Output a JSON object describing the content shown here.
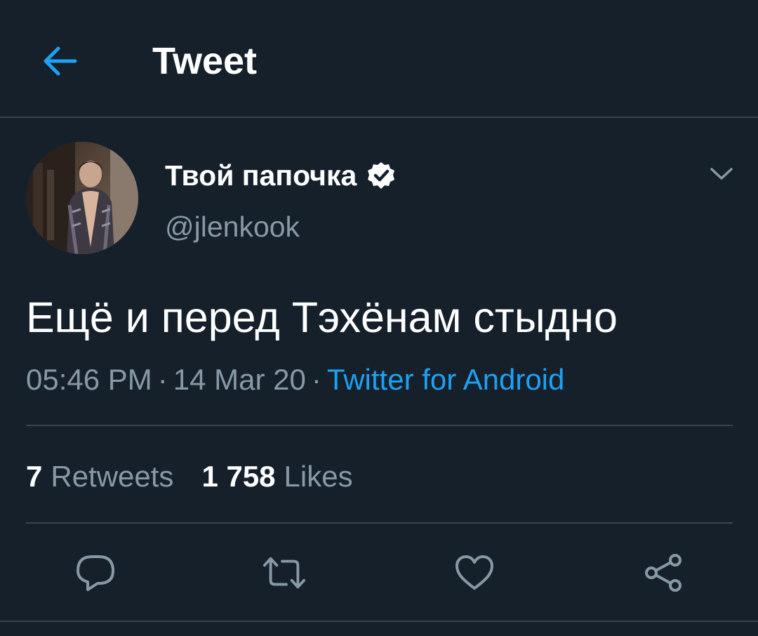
{
  "header": {
    "title": "Tweet",
    "back_icon": "arrow-left-icon"
  },
  "author": {
    "display_name": "Твой папочка",
    "handle": "@jlenkook",
    "verified": true,
    "verified_icon": "verified-badge-icon",
    "menu_icon": "chevron-down-icon"
  },
  "tweet": {
    "text": "Ещё и перед Тэхёнам стыдно",
    "time": "05:46 PM",
    "separator": "·",
    "date": "14 Mar 20",
    "source": "Twitter for Android"
  },
  "stats": {
    "retweets_count": "7",
    "retweets_label": "Retweets",
    "likes_count": "1 758",
    "likes_label": "Likes"
  },
  "actions": [
    {
      "name": "reply",
      "icon": "comment-icon"
    },
    {
      "name": "retweet",
      "icon": "retweet-icon"
    },
    {
      "name": "like",
      "icon": "heart-icon"
    },
    {
      "name": "share",
      "icon": "share-icon"
    }
  ],
  "colors": {
    "background": "#15202b",
    "accent": "#1da1f2",
    "secondary_text": "#8899a6",
    "divider": "#38444d",
    "primary_text": "#ffffff"
  }
}
